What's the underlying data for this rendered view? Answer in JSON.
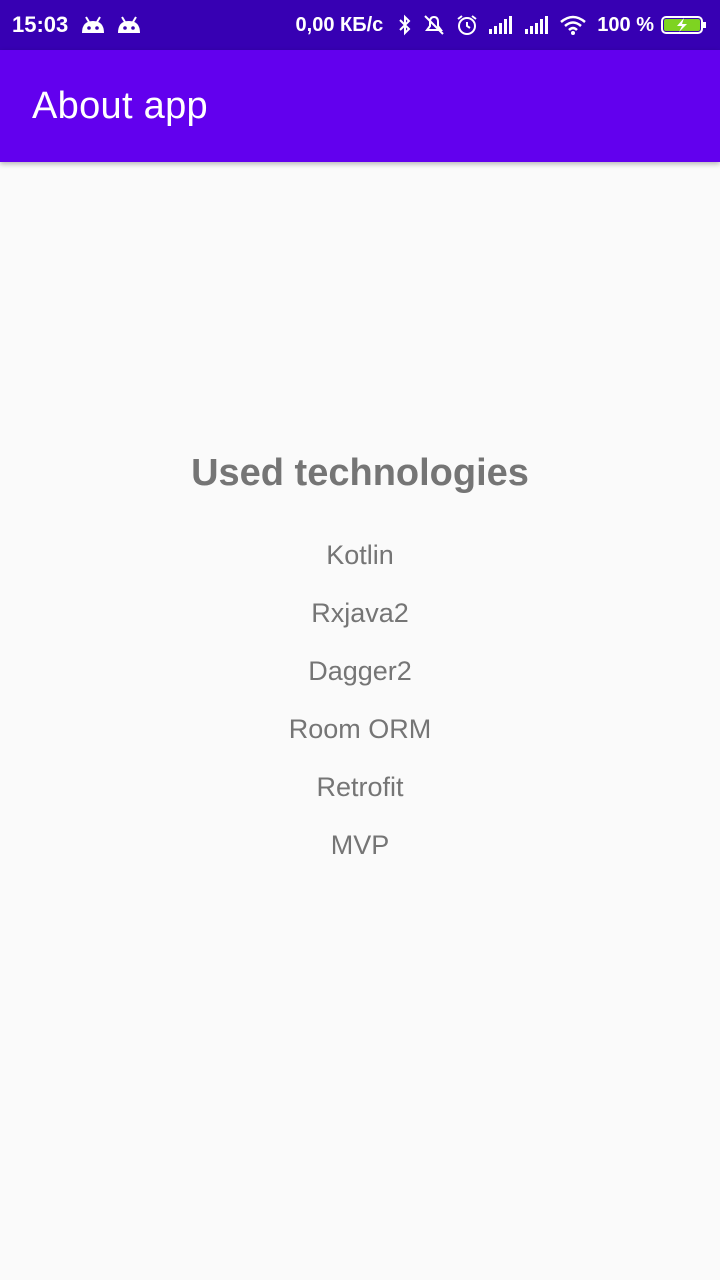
{
  "status_bar": {
    "time": "15:03",
    "network_speed": "0,00 КБ/с",
    "battery_percent": "100 %",
    "icons": [
      "android-icon",
      "android-icon",
      "bluetooth-icon",
      "mute-icon",
      "alarm-icon",
      "signal-icon",
      "signal-icon",
      "wifi-icon",
      "battery-charging-icon"
    ],
    "background_color": "#3700b3"
  },
  "app_bar": {
    "title": "About app",
    "background_color": "#6200ee"
  },
  "content": {
    "heading": "Used technologies",
    "technologies": [
      "Kotlin",
      "Rxjava2",
      "Dagger2",
      "Room ORM",
      "Retrofit",
      "MVP"
    ],
    "text_color": "#757575"
  }
}
